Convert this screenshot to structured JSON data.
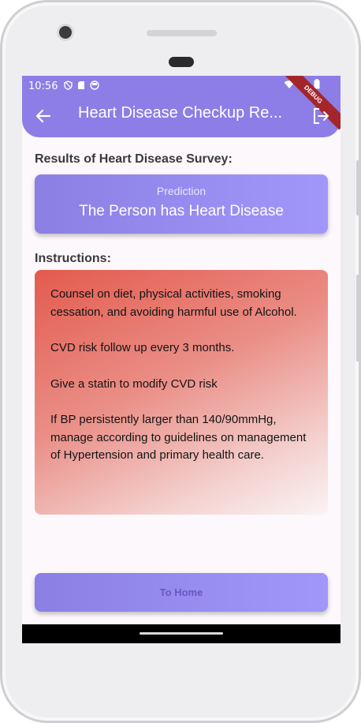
{
  "status_bar": {
    "time": "10:56",
    "debug_label": "DEBUG",
    "icons": [
      "shield-icon",
      "sd-card-icon",
      "face-icon",
      "wifi-icon",
      "signal-icon",
      "battery-icon"
    ]
  },
  "app_bar": {
    "title": "Heart Disease Checkup Re...",
    "back_icon": "arrow-left-icon",
    "logout_icon": "logout-icon",
    "color": "#8c7ee6"
  },
  "results": {
    "heading": "Results of Heart Disease Survey:",
    "prediction_label": "Prediction",
    "prediction_value": "The Person has Heart Disease"
  },
  "instructions": {
    "heading": "Instructions:",
    "paragraphs": [
      "Counsel on diet, physical activities, smoking cessation, and avoiding harmful use of Alcohol.",
      "CVD risk follow up every 3 months.",
      "Give a statin to modify CVD risk",
      "If BP persistently larger than 140/90mmHg, manage according to guidelines on management of Hypertension and primary health care."
    ],
    "gradient_colors": [
      "#e35a4e",
      "#faf3f4"
    ]
  },
  "footer": {
    "home_button_label": "To Home"
  },
  "colors": {
    "accent": "#8c7ee6",
    "accent_light": "#a197fb",
    "background": "#fdf8fc"
  }
}
